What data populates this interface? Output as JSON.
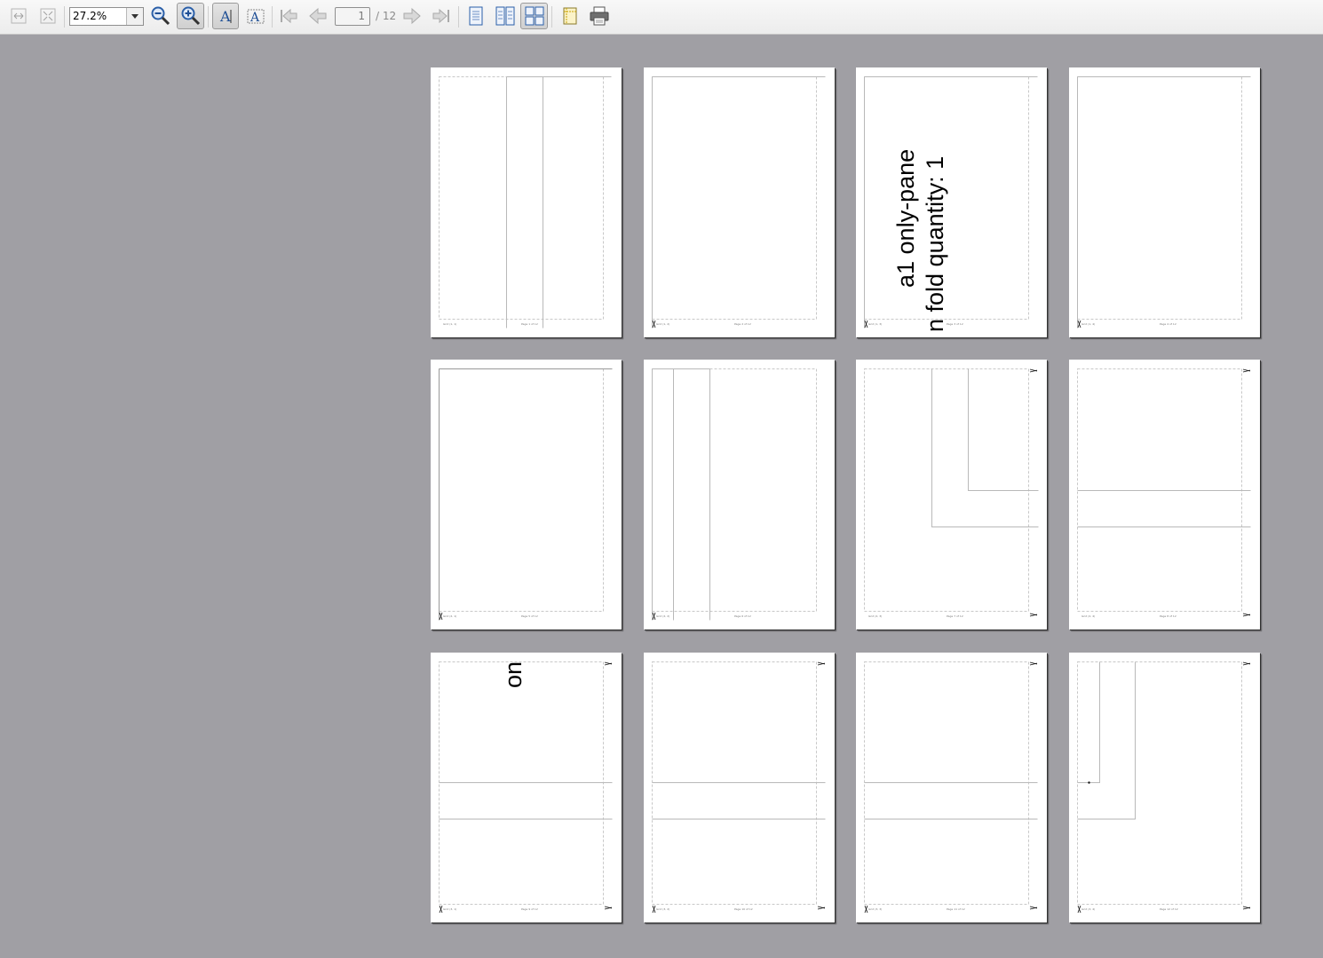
{
  "toolbar": {
    "zoom_value": "27.2%",
    "current_page": "1",
    "page_count": "/ 12",
    "icons": [
      "fit-width-icon",
      "fit-page-icon",
      "zoom-out-icon",
      "zoom-in-icon",
      "text-select-icon",
      "text-edit-icon",
      "first-page-icon",
      "previous-page-icon",
      "next-page-icon",
      "last-page-icon",
      "single-page-icon",
      "two-page-icon",
      "multi-page-icon",
      "margins-icon",
      "print-icon"
    ],
    "accent_color": "#1f5aa6"
  },
  "pages": [
    {
      "footer_left": "Grid (1, 1)",
      "footer_center": "Page 1 of 12"
    },
    {
      "footer_left": "Grid (1, 2)",
      "footer_center": "Page 2 of 12"
    },
    {
      "footer_left": "Grid (1, 3)",
      "footer_center": "Page 3 of 12",
      "text_line1": "a1 only-pane",
      "text_line2": "n fold quantity: 1"
    },
    {
      "footer_left": "Grid (1, 4)",
      "footer_center": "Page 4 of 12"
    },
    {
      "footer_left": "Grid (2, 1)",
      "footer_center": "Page 5 of 12"
    },
    {
      "footer_left": "Grid (2, 2)",
      "footer_center": "Page 6 of 12"
    },
    {
      "footer_left": "Grid (2, 3)",
      "footer_center": "Page 7 of 12"
    },
    {
      "footer_left": "Grid (2, 4)",
      "footer_center": "Page 8 of 12"
    },
    {
      "footer_left": "Grid (3, 1)",
      "footer_center": "Page 9 of 12",
      "text_fragment": "on"
    },
    {
      "footer_left": "Grid (3, 2)",
      "footer_center": "Page 10 of 12"
    },
    {
      "footer_left": "Grid (3, 3)",
      "footer_center": "Page 11 of 12"
    },
    {
      "footer_left": "Grid (3, 4)",
      "footer_center": "Page 12 of 12"
    }
  ]
}
